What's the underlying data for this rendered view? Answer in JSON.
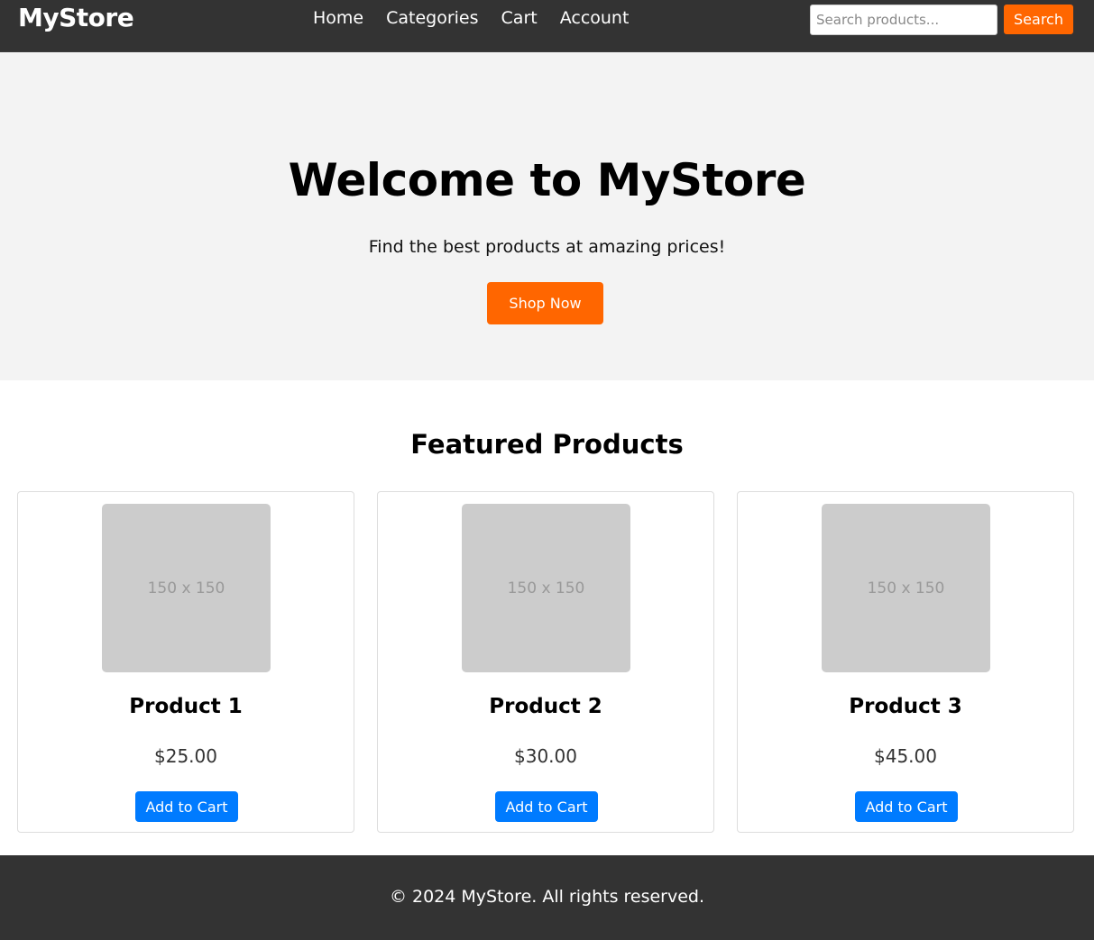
{
  "header": {
    "logo": "MyStore",
    "nav": [
      "Home",
      "Categories",
      "Cart",
      "Account"
    ],
    "search_placeholder": "Search products...",
    "search_button": "Search"
  },
  "hero": {
    "title": "Welcome to MyStore",
    "subtitle": "Find the best products at amazing prices!",
    "cta": "Shop Now"
  },
  "featured": {
    "title": "Featured Products",
    "products": [
      {
        "image_label": "150 x 150",
        "name": "Product 1",
        "price": "$25.00",
        "button": "Add to Cart"
      },
      {
        "image_label": "150 x 150",
        "name": "Product 2",
        "price": "$30.00",
        "button": "Add to Cart"
      },
      {
        "image_label": "150 x 150",
        "name": "Product 3",
        "price": "$45.00",
        "button": "Add to Cart"
      }
    ]
  },
  "footer": {
    "text": "© 2024 MyStore. All rights reserved."
  },
  "colors": {
    "header_bg": "#333333",
    "accent_orange": "#ff6600",
    "button_blue": "#007bff",
    "hero_bg": "#f3f3f3",
    "placeholder_gray": "#cccccc"
  }
}
